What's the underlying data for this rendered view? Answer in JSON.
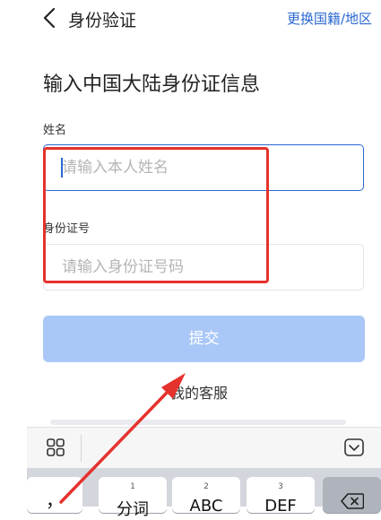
{
  "header": {
    "title": "身份验证",
    "switch_link": "更换国籍/地区"
  },
  "form": {
    "heading": "输入中国大陆身份证信息",
    "name_label": "姓名",
    "name_placeholder": "请输入本人姓名",
    "id_label": "身份证号",
    "id_placeholder": "请输入身份证号码",
    "submit_label": "提交",
    "service_link": "我的客服"
  },
  "keyboard": {
    "keys": [
      {
        "hint": "",
        "label": "，"
      },
      {
        "hint": "1",
        "label": "分词"
      },
      {
        "hint": "2",
        "label": "ABC"
      },
      {
        "hint": "3",
        "label": "DEF"
      }
    ]
  },
  "colors": {
    "accent": "#2a67d1",
    "submit_disabled": "#a9c8f7",
    "annotation_red": "#e5322d"
  },
  "icons": [
    "back-chevron-icon",
    "keyboard-grid-icon",
    "keyboard-collapse-icon",
    "backspace-icon",
    "annotation-arrow"
  ]
}
